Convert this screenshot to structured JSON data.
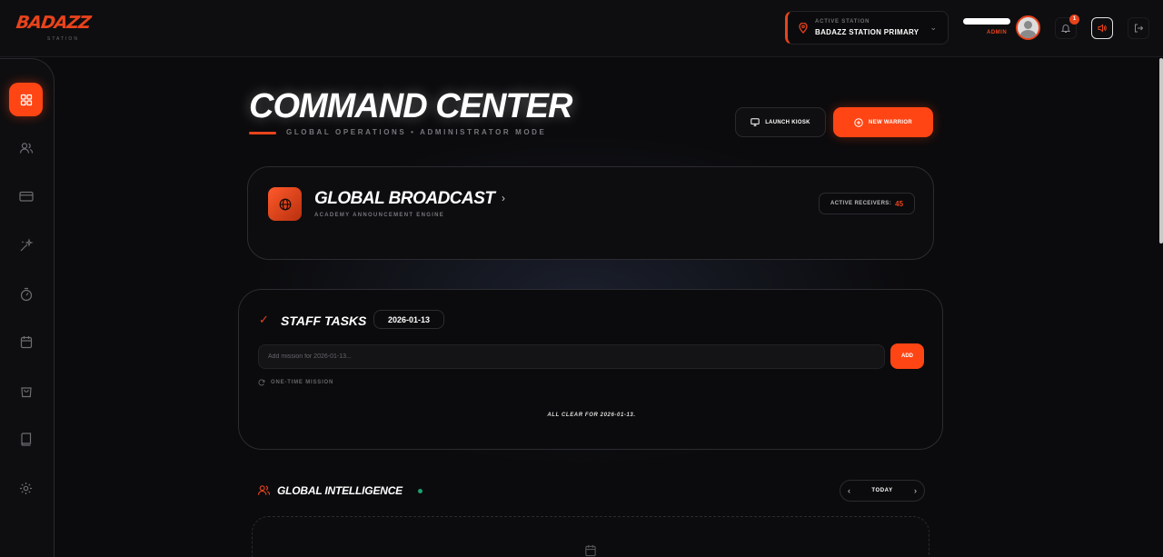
{
  "brand": {
    "name": "BADAZZ",
    "sub": "STATION"
  },
  "topbar": {
    "station_label": "ACTIVE STATION",
    "station_value": "BADAZZ STATION PRIMARY",
    "user_role": "ADMIN",
    "notification_count": "1",
    "accent_color": "#ff4514"
  },
  "sidebar": {
    "items": [
      {
        "icon": "dashboard-icon",
        "active": true
      },
      {
        "icon": "users-icon"
      },
      {
        "icon": "credit-card-icon"
      },
      {
        "icon": "sparkles-icon"
      },
      {
        "icon": "timer-icon"
      },
      {
        "icon": "calendar-icon"
      },
      {
        "icon": "shopping-bag-icon"
      },
      {
        "icon": "book-icon"
      },
      {
        "icon": "settings-icon"
      }
    ]
  },
  "header": {
    "title_part1": "COMMAND",
    "title_part2": "CENTER",
    "subtitle": "GLOBAL OPERATIONS • ADMINISTRATOR MODE",
    "kiosk_label": "LAUNCH KIOSK",
    "new_warrior_label": "NEW WARRIOR"
  },
  "broadcast": {
    "title": "GLOBAL BROADCAST",
    "subtitle": "ACADEMY ANNOUNCEMENT ENGINE",
    "receivers_label": "ACTIVE RECEIVERS:",
    "receivers_count": "45"
  },
  "tasks": {
    "title": "STAFF TASKS",
    "date": "2026-01-13",
    "input_placeholder": "Add mission for 2026-01-13...",
    "add_label": "ADD",
    "one_time_label": "ONE-TIME MISSION",
    "empty_message": "ALL CLEAR FOR 2026-01-13."
  },
  "intelligence": {
    "title": "GLOBAL INTELLIGENCE",
    "nav_label": "TODAY",
    "status_color": "#1d9f6e"
  }
}
